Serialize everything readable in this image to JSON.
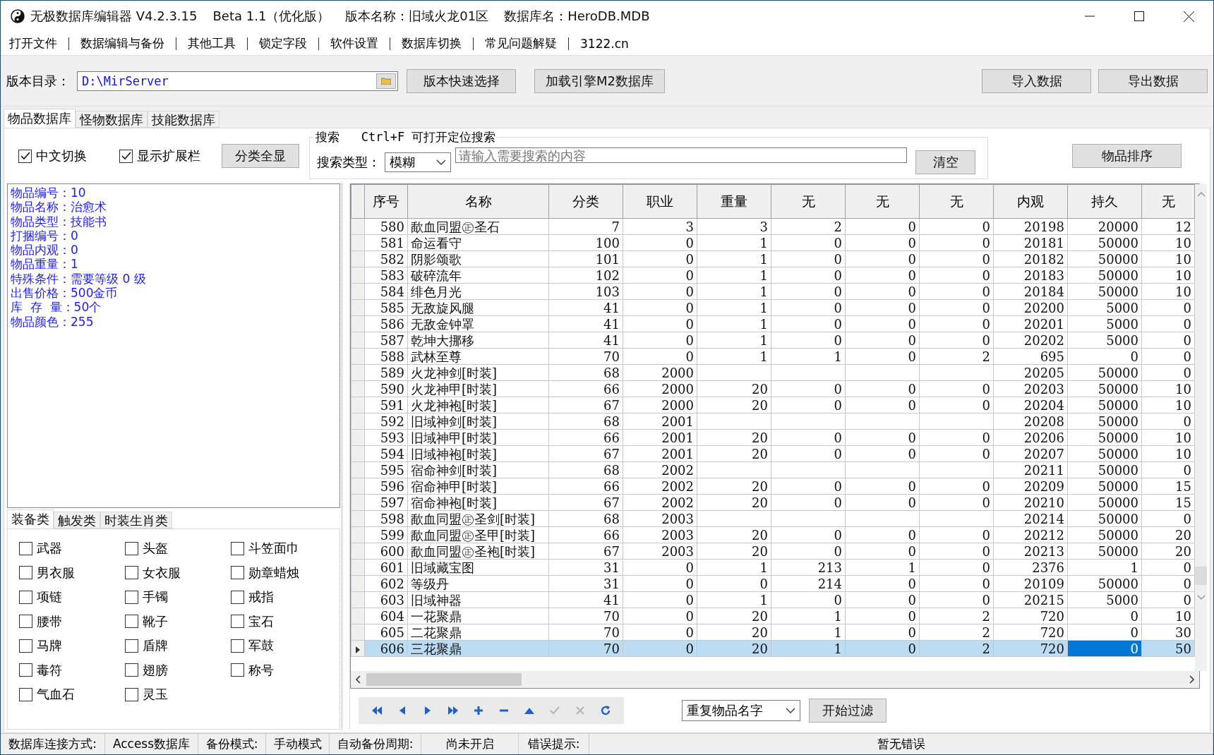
{
  "title_bar": {
    "app_title": "无极数据库编辑器 V4.2.3.15",
    "beta": "Beta 1.1（优化版）",
    "version_name": "版本名称：旧域火龙01区",
    "db_name": "数据库名：HeroDB.MDB"
  },
  "menu": [
    "打开文件",
    "数据编辑与备份",
    "其他工具",
    "锁定字段",
    "软件设置",
    "数据库切换",
    "常见问题解疑",
    "3122.cn"
  ],
  "toolbar": {
    "dir_label": "版本目录：",
    "dir_value": "D:\\MirServer",
    "buttons": [
      "版本快速选择",
      "加载引擎M2数据库"
    ],
    "right_buttons": [
      "导入数据",
      "导出数据"
    ]
  },
  "tabs": [
    {
      "label": "物品数据库",
      "selected": true
    },
    {
      "label": "怪物数据库",
      "selected": false
    },
    {
      "label": "技能数据库",
      "selected": false
    }
  ],
  "options": {
    "checkboxes": [
      {
        "label": "中文切换",
        "checked": true
      },
      {
        "label": "显示扩展栏",
        "checked": true
      }
    ],
    "show_all_button": "分类全显"
  },
  "search": {
    "legend": "搜索   Ctrl+F 可打开定位搜索",
    "type_label": "搜索类型：",
    "type_value": "模糊",
    "placeholder": "请输入需要搜索的内容",
    "clear_button": "清空"
  },
  "sort_button": "物品排序",
  "info_lines": [
    "物品编号：10",
    "物品名称：治愈术",
    "物品类型：技能书",
    "打捆编号：0",
    "物品内观：0",
    "物品重量：1",
    "特殊条件：需要等级 0 级",
    "出售价格：500金币",
    "库  存  量：50个",
    "物品颜色：255"
  ],
  "category_tabs": [
    {
      "label": "装备类",
      "selected": true
    },
    {
      "label": "触发类",
      "selected": false
    },
    {
      "label": "时装生肖类",
      "selected": false
    }
  ],
  "category_checkboxes": [
    {
      "label": "武器",
      "checked": false
    },
    {
      "label": "头盔",
      "checked": false
    },
    {
      "label": "斗笠面巾",
      "checked": false
    },
    {
      "label": "男衣服",
      "checked": false
    },
    {
      "label": "女衣服",
      "checked": false
    },
    {
      "label": "勋章蜡烛",
      "checked": false
    },
    {
      "label": "项链",
      "checked": false
    },
    {
      "label": "手镯",
      "checked": false
    },
    {
      "label": "戒指",
      "checked": false
    },
    {
      "label": "腰带",
      "checked": false
    },
    {
      "label": "靴子",
      "checked": false
    },
    {
      "label": "宝石",
      "checked": false
    },
    {
      "label": "马牌",
      "checked": false
    },
    {
      "label": "盾牌",
      "checked": false
    },
    {
      "label": "军鼓",
      "checked": false
    },
    {
      "label": "毒符",
      "checked": false
    },
    {
      "label": "翅膀",
      "checked": false
    },
    {
      "label": "称号",
      "checked": false
    },
    {
      "label": "气血石",
      "checked": false
    },
    {
      "label": "灵玉",
      "checked": false
    }
  ],
  "table": {
    "columns": [
      "序号",
      "名称",
      "分类",
      "职业",
      "重量",
      "无",
      "无",
      "无",
      "内观",
      "持久",
      "无"
    ],
    "rows": [
      {
        "selected": false,
        "cells": [
          "580",
          "歃血同盟㊣圣石",
          "7",
          "3",
          "3",
          "2",
          "0",
          "0",
          "20198",
          "20000",
          "12"
        ]
      },
      {
        "selected": false,
        "cells": [
          "581",
          "命运看守",
          "100",
          "0",
          "1",
          "0",
          "0",
          "0",
          "20181",
          "50000",
          "10"
        ]
      },
      {
        "selected": false,
        "cells": [
          "582",
          "阴影颂歌",
          "101",
          "0",
          "1",
          "0",
          "0",
          "0",
          "20182",
          "50000",
          "10"
        ]
      },
      {
        "selected": false,
        "cells": [
          "583",
          "破碎流年",
          "102",
          "0",
          "1",
          "0",
          "0",
          "0",
          "20183",
          "50000",
          "10"
        ]
      },
      {
        "selected": false,
        "cells": [
          "584",
          "绯色月光",
          "103",
          "0",
          "1",
          "0",
          "0",
          "0",
          "20184",
          "50000",
          "10"
        ]
      },
      {
        "selected": false,
        "cells": [
          "585",
          "无敌旋风腿",
          "41",
          "0",
          "1",
          "0",
          "0",
          "0",
          "20200",
          "5000",
          "0"
        ]
      },
      {
        "selected": false,
        "cells": [
          "586",
          "无敌金钟罩",
          "41",
          "0",
          "1",
          "0",
          "0",
          "0",
          "20201",
          "5000",
          "0"
        ]
      },
      {
        "selected": false,
        "cells": [
          "587",
          "乾坤大挪移",
          "41",
          "0",
          "1",
          "0",
          "0",
          "0",
          "20202",
          "5000",
          "0"
        ]
      },
      {
        "selected": false,
        "cells": [
          "588",
          "武林至尊",
          "70",
          "0",
          "1",
          "1",
          "0",
          "2",
          "695",
          "0",
          "0"
        ]
      },
      {
        "selected": false,
        "cells": [
          "589",
          "火龙神剑[时装]",
          "68",
          "2000",
          null,
          null,
          null,
          null,
          "20205",
          "50000",
          "0"
        ]
      },
      {
        "selected": false,
        "cells": [
          "590",
          "火龙神甲[时装]",
          "66",
          "2000",
          "20",
          "0",
          "0",
          "0",
          "20203",
          "50000",
          "10"
        ]
      },
      {
        "selected": false,
        "cells": [
          "591",
          "火龙神袍[时装]",
          "67",
          "2000",
          "20",
          "0",
          "0",
          "0",
          "20204",
          "50000",
          "10"
        ]
      },
      {
        "selected": false,
        "cells": [
          "592",
          "旧域神剑[时装]",
          "68",
          "2001",
          null,
          null,
          null,
          null,
          "20208",
          "50000",
          "0"
        ]
      },
      {
        "selected": false,
        "cells": [
          "593",
          "旧域神甲[时装]",
          "66",
          "2001",
          "20",
          "0",
          "0",
          "0",
          "20206",
          "50000",
          "10"
        ]
      },
      {
        "selected": false,
        "cells": [
          "594",
          "旧域神袍[时装]",
          "67",
          "2001",
          "20",
          "0",
          "0",
          "0",
          "20207",
          "50000",
          "10"
        ]
      },
      {
        "selected": false,
        "cells": [
          "595",
          "宿命神剑[时装]",
          "68",
          "2002",
          null,
          null,
          null,
          null,
          "20211",
          "50000",
          "0"
        ]
      },
      {
        "selected": false,
        "cells": [
          "596",
          "宿命神甲[时装]",
          "66",
          "2002",
          "20",
          "0",
          "0",
          "0",
          "20209",
          "50000",
          "15"
        ]
      },
      {
        "selected": false,
        "cells": [
          "597",
          "宿命神袍[时装]",
          "67",
          "2002",
          "20",
          "0",
          "0",
          "0",
          "20210",
          "50000",
          "15"
        ]
      },
      {
        "selected": false,
        "cells": [
          "598",
          "歃血同盟㊣圣剑[时装]",
          "68",
          "2003",
          null,
          null,
          null,
          null,
          "20214",
          "50000",
          "0"
        ]
      },
      {
        "selected": false,
        "cells": [
          "599",
          "歃血同盟㊣圣甲[时装]",
          "66",
          "2003",
          "20",
          "0",
          "0",
          "0",
          "20212",
          "50000",
          "20"
        ]
      },
      {
        "selected": false,
        "cells": [
          "600",
          "歃血同盟㊣圣袍[时装]",
          "67",
          "2003",
          "20",
          "0",
          "0",
          "0",
          "20213",
          "50000",
          "20"
        ]
      },
      {
        "selected": false,
        "cells": [
          "601",
          "旧域藏宝图",
          "31",
          "0",
          "1",
          "213",
          "1",
          "0",
          "2376",
          "1",
          "0"
        ]
      },
      {
        "selected": false,
        "cells": [
          "602",
          "等级丹",
          "31",
          "0",
          "0",
          "214",
          "0",
          "0",
          "20109",
          "50000",
          "0"
        ]
      },
      {
        "selected": false,
        "cells": [
          "603",
          "旧域神器",
          "41",
          "0",
          "1",
          "0",
          "0",
          "0",
          "20215",
          "5000",
          "0"
        ]
      },
      {
        "selected": false,
        "cells": [
          "604",
          "一花聚鼎",
          "70",
          "0",
          "20",
          "1",
          "0",
          "2",
          "720",
          "0",
          "10"
        ]
      },
      {
        "selected": false,
        "cells": [
          "605",
          "二花聚鼎",
          "70",
          "0",
          "20",
          "1",
          "0",
          "2",
          "720",
          "0",
          "30"
        ]
      },
      {
        "selected": true,
        "cells": [
          "606",
          "三花聚鼎",
          "70",
          "0",
          "20",
          "1",
          "0",
          "2",
          "720",
          {
            "text": "0",
            "focused": true
          },
          "50"
        ]
      }
    ]
  },
  "nav_buttons": [
    {
      "kind": "first",
      "disabled": false
    },
    {
      "kind": "prior",
      "disabled": false
    },
    {
      "kind": "next",
      "disabled": false
    },
    {
      "kind": "last",
      "disabled": false
    },
    {
      "kind": "insert",
      "disabled": false
    },
    {
      "kind": "delete",
      "disabled": false
    },
    {
      "kind": "edit",
      "disabled": false
    },
    {
      "kind": "post",
      "disabled": true
    },
    {
      "kind": "cancel",
      "disabled": true
    },
    {
      "kind": "refresh",
      "disabled": false
    }
  ],
  "filter": {
    "value": "重复物品名字",
    "button": "开始过滤"
  },
  "status_bar": [
    "数据库连接方式:",
    "Access数据库",
    "备份模式:",
    "手动模式",
    "自动备份周期:",
    "尚未开启",
    "错误提示:",
    "暂无错误"
  ]
}
